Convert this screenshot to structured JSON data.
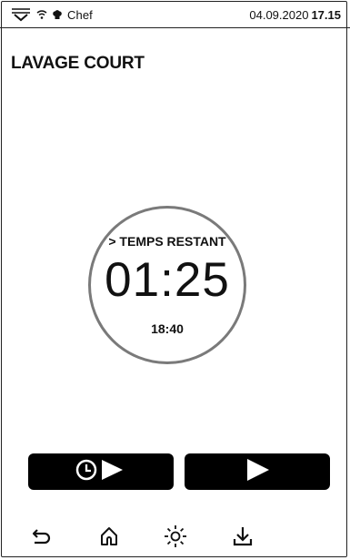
{
  "status": {
    "user": "Chef",
    "date": "04.09.2020",
    "time": "17.15",
    "icons": [
      "menu-down-icon",
      "wifi-icon",
      "chef-hat-icon"
    ]
  },
  "screen": {
    "title": "LAVAGE COURT"
  },
  "timer": {
    "label": "> TEMPS RESTANT",
    "remaining": "01:25",
    "end_time": "18:40"
  },
  "actions": {
    "delayed_start_icon": "clock-play-icon",
    "start_icon": "play-icon"
  },
  "nav": {
    "icons": [
      "back-icon",
      "home-icon",
      "light-icon",
      "download-icon"
    ]
  },
  "colors": {
    "circle": "#7a7a7a",
    "button_bg": "#000000",
    "button_fg": "#ffffff"
  }
}
